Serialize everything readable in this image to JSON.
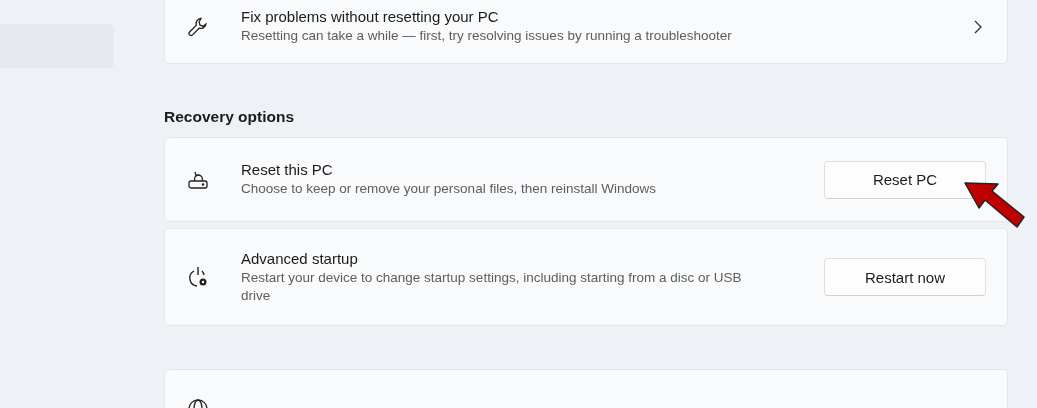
{
  "cards_top": [
    {
      "kind": "wrench",
      "title": "Fix problems without resetting your PC",
      "description": "Resetting can take a while — first, try resolving issues by running a troubleshooter",
      "action": {
        "kind": "chevron"
      }
    }
  ],
  "section": {
    "heading": "Recovery options",
    "cards": [
      {
        "kind": "reset",
        "title": "Reset this PC",
        "description": "Choose to keep or remove your personal files, then reinstall Windows",
        "action": {
          "kind": "button",
          "label": "Reset PC"
        }
      },
      {
        "kind": "power-gear",
        "title": "Advanced startup",
        "description": "Restart your device to change startup settings, including starting from a disc or USB drive",
        "action": {
          "kind": "button",
          "label": "Restart now"
        }
      }
    ]
  },
  "cards_bottom": [
    {
      "kind": "globe"
    }
  ],
  "callout_arrow": true
}
